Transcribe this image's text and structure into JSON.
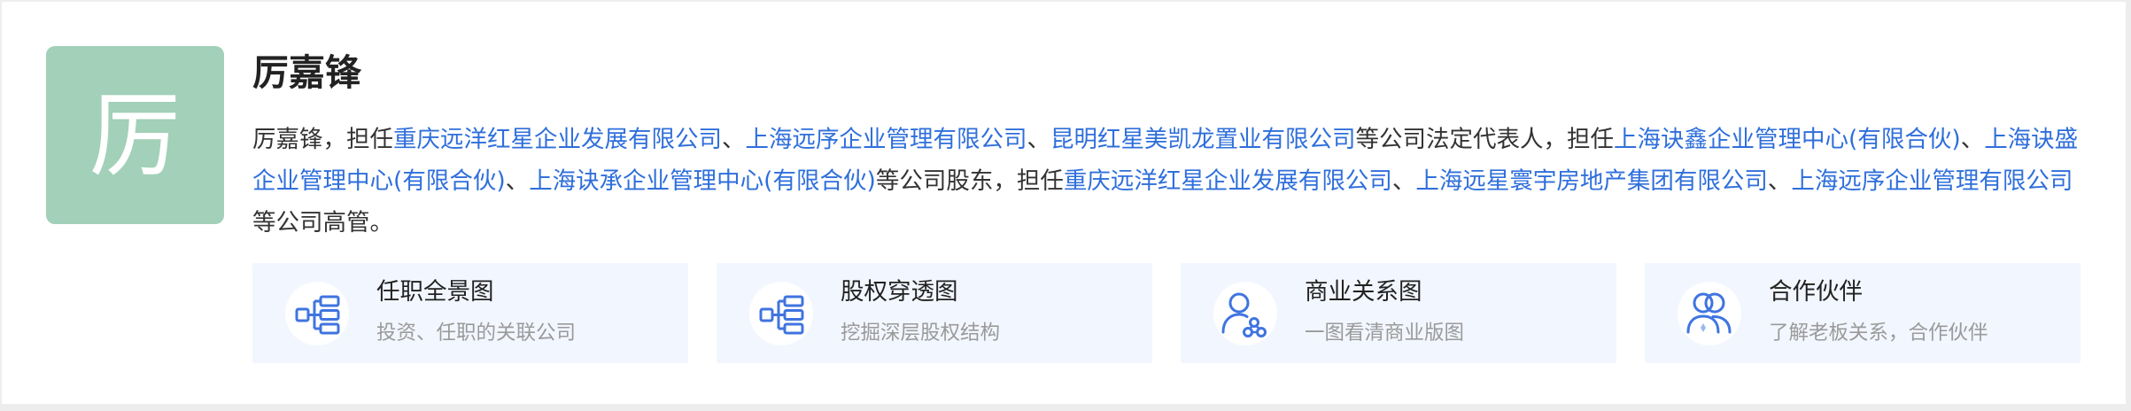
{
  "person": {
    "avatar_char": "厉",
    "name": "厉嘉锋"
  },
  "description": {
    "segments": [
      {
        "text": "厉嘉锋，担任",
        "link": false
      },
      {
        "text": "重庆远洋红星企业发展有限公司",
        "link": true
      },
      {
        "text": "、",
        "link": false
      },
      {
        "text": "上海远序企业管理有限公司",
        "link": true
      },
      {
        "text": "、",
        "link": false
      },
      {
        "text": "昆明红星美凯龙置业有限公司",
        "link": true
      },
      {
        "text": "等公司法定代表人，担任",
        "link": false
      },
      {
        "text": "上海诀鑫企业管理中心(有限合伙)",
        "link": true
      },
      {
        "text": "、",
        "link": false
      },
      {
        "text": "上海诀盛企业管理中心(有限合伙)",
        "link": true
      },
      {
        "text": "、",
        "link": false
      },
      {
        "text": "上海诀承企业管理中心(有限合伙)",
        "link": true
      },
      {
        "text": "等公司股东，担任",
        "link": false
      },
      {
        "text": "重庆远洋红星企业发展有限公司",
        "link": true
      },
      {
        "text": "、",
        "link": false
      },
      {
        "text": "上海远星寰宇房地产集团有限公司",
        "link": true
      },
      {
        "text": "、",
        "link": false
      },
      {
        "text": "上海远序企业管理有限公司",
        "link": true
      },
      {
        "text": "等公司高管。",
        "link": false
      }
    ]
  },
  "tiles": [
    {
      "title": "任职全景图",
      "subtitle": "投资、任职的关联公司",
      "icon": "org-tree-icon"
    },
    {
      "title": "股权穿透图",
      "subtitle": "挖掘深层股权结构",
      "icon": "equity-tree-icon"
    },
    {
      "title": "商业关系图",
      "subtitle": "一图看清商业版图",
      "icon": "person-network-icon"
    },
    {
      "title": "合作伙伴",
      "subtitle": "了解老板关系，合作伙伴",
      "icon": "partners-icon"
    }
  ],
  "colors": {
    "avatar_bg": "#a2d0b8",
    "link": "#2f6fdb",
    "tile_bg": "#f2f6fe",
    "icon_blue": "#3f74e0"
  }
}
